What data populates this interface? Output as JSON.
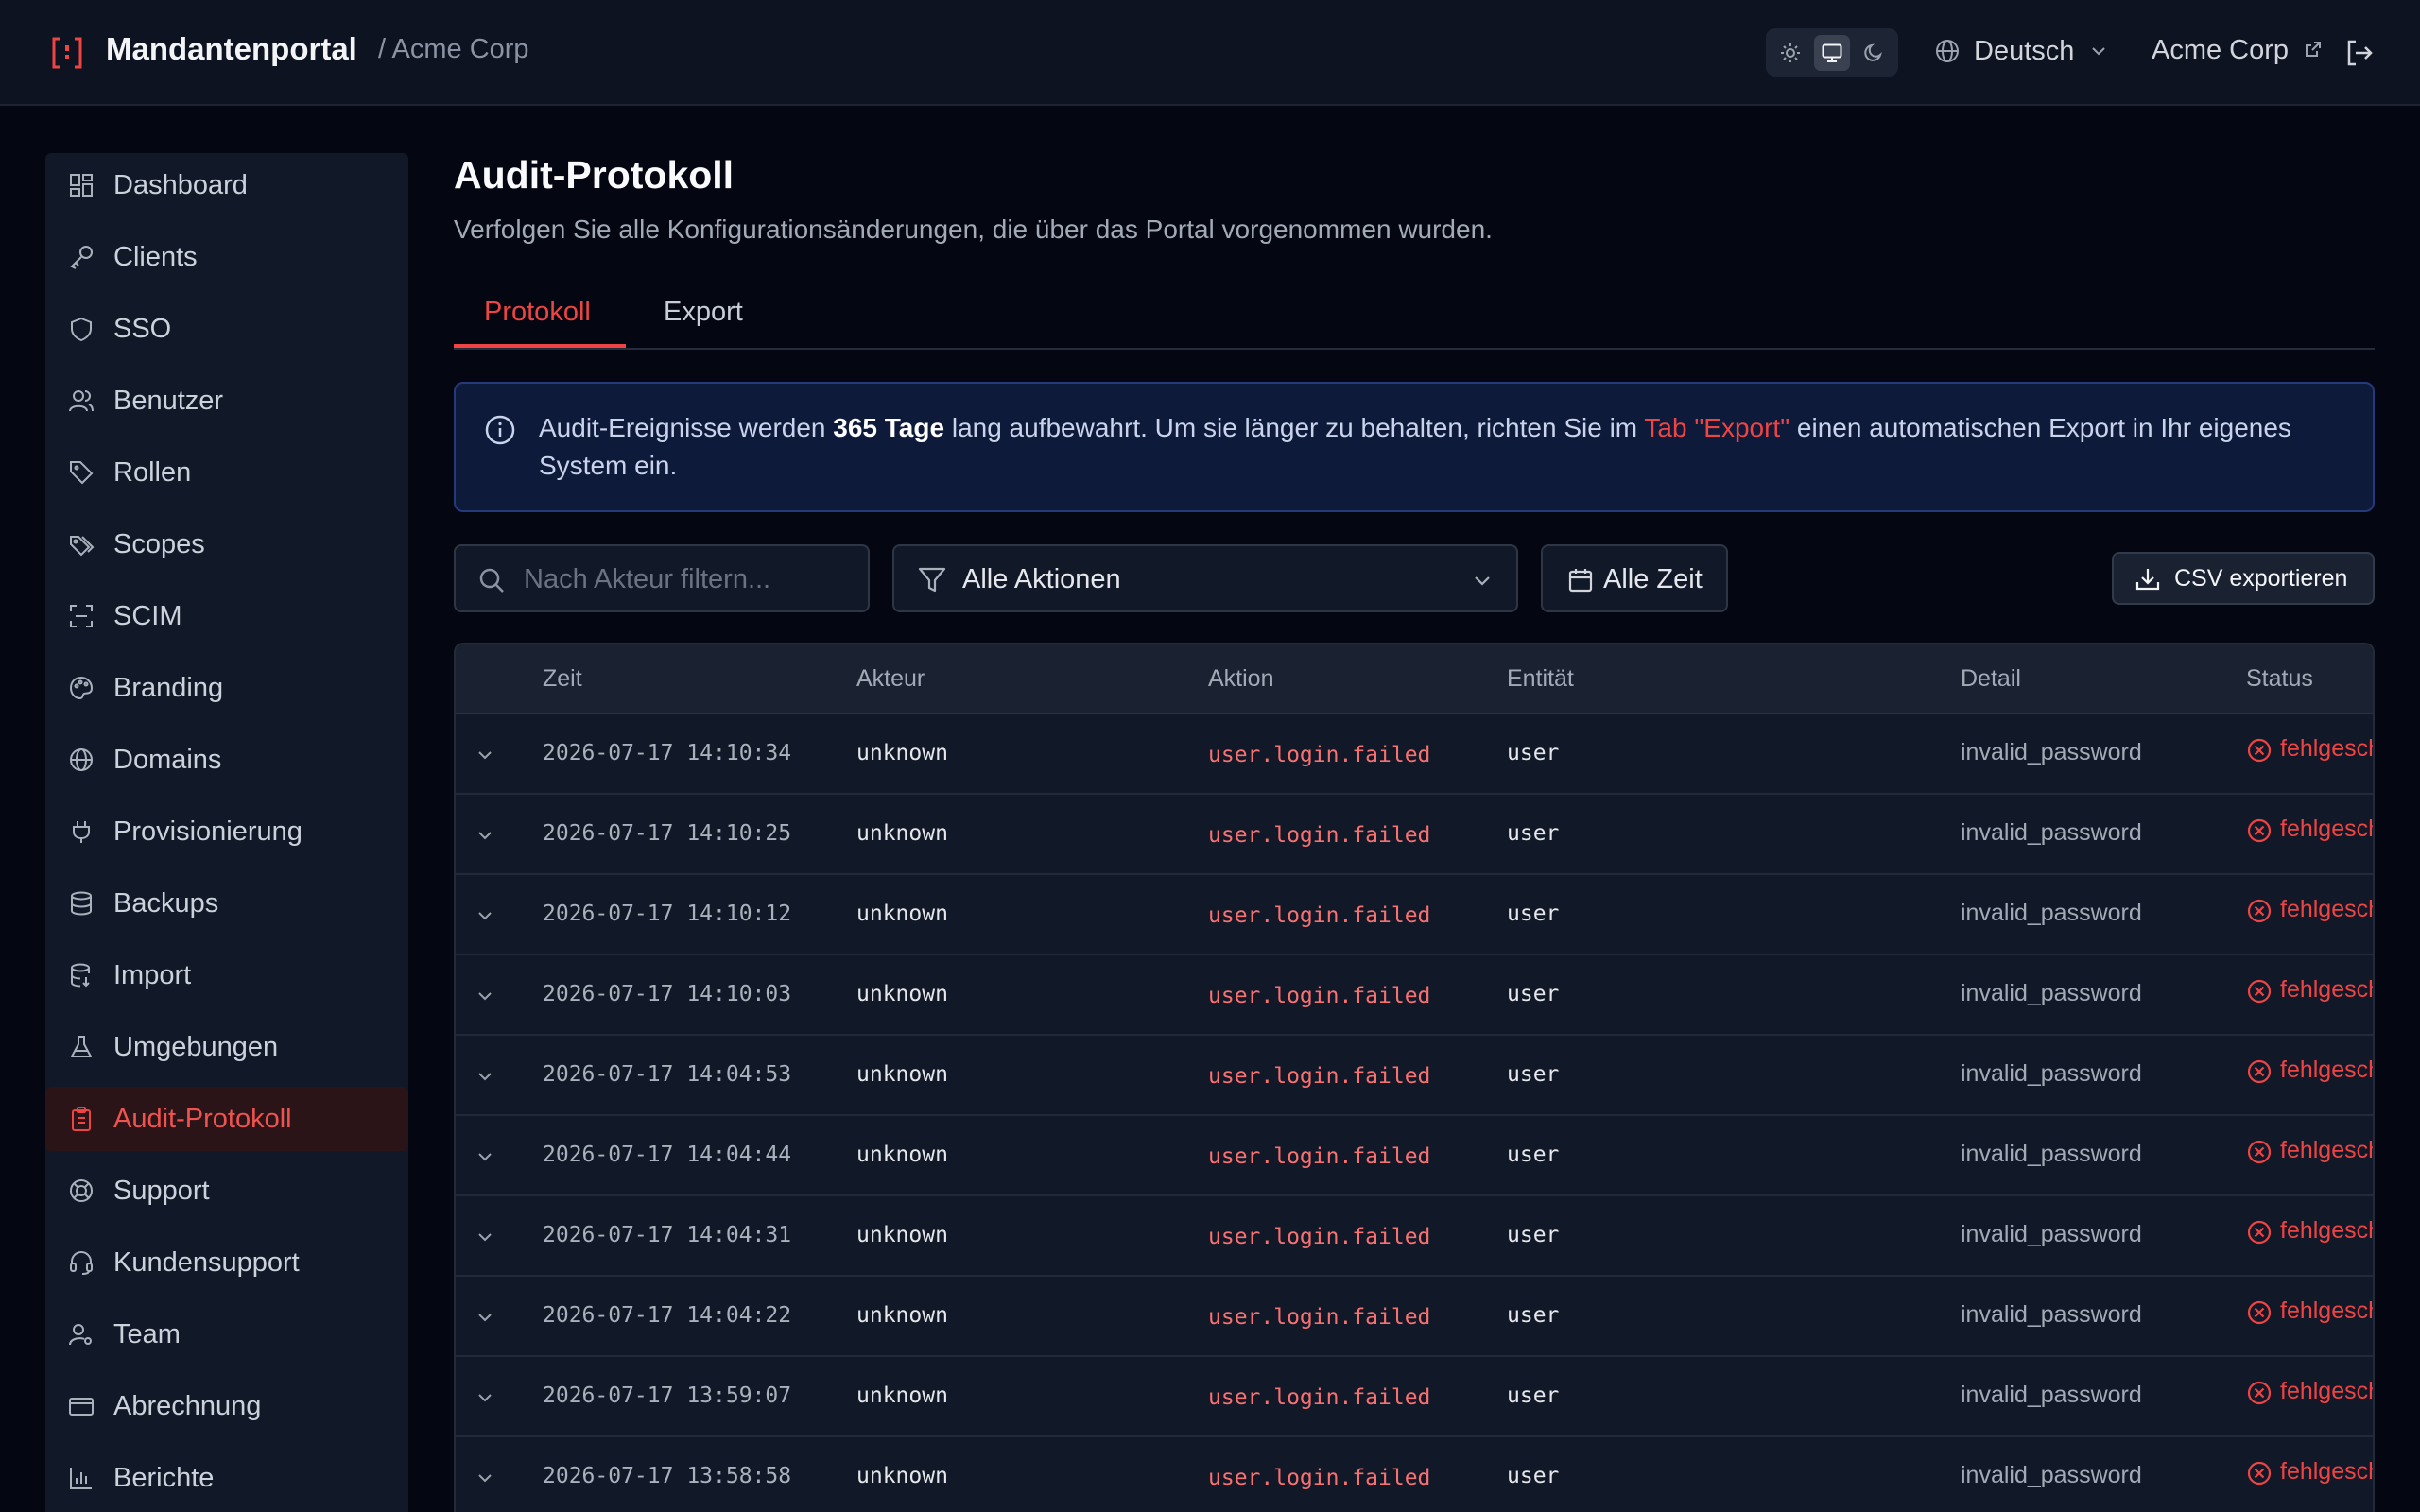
{
  "header": {
    "brand": "Mandantenportal",
    "crumb": "/ Acme Corp",
    "theme_options": [
      "light-icon",
      "monitor-icon",
      "moon-icon"
    ],
    "theme_selected": "monitor-icon",
    "language": "Deutsch",
    "tenant_link": "Acme Corp"
  },
  "sidebar": {
    "items": [
      {
        "label": "Dashboard",
        "icon": "dashboard-icon"
      },
      {
        "label": "Clients",
        "icon": "key-icon"
      },
      {
        "label": "SSO",
        "icon": "shield-icon"
      },
      {
        "label": "Benutzer",
        "icon": "users-icon"
      },
      {
        "label": "Rollen",
        "icon": "tag-icon"
      },
      {
        "label": "Scopes",
        "icon": "tags-icon"
      },
      {
        "label": "SCIM",
        "icon": "scan-icon"
      },
      {
        "label": "Branding",
        "icon": "palette-icon"
      },
      {
        "label": "Domains",
        "icon": "globe-icon"
      },
      {
        "label": "Provisionierung",
        "icon": "plug-icon"
      },
      {
        "label": "Backups",
        "icon": "database-icon"
      },
      {
        "label": "Import",
        "icon": "database-import-icon"
      },
      {
        "label": "Umgebungen",
        "icon": "flask-icon"
      },
      {
        "label": "Audit-Protokoll",
        "icon": "clipboard-icon"
      },
      {
        "label": "Support",
        "icon": "lifebuoy-icon"
      },
      {
        "label": "Kundensupport",
        "icon": "headset-icon"
      },
      {
        "label": "Team",
        "icon": "user-cog-icon"
      },
      {
        "label": "Abrechnung",
        "icon": "credit-card-icon"
      },
      {
        "label": "Berichte",
        "icon": "bar-chart-icon"
      }
    ],
    "active": "Audit-Protokoll"
  },
  "main": {
    "title": "Audit-Protokoll",
    "subtitle": "Verfolgen Sie alle Konfigurationsänderungen, die über das Portal vorgenommen wurden.",
    "tabs": [
      {
        "label": "Protokoll"
      },
      {
        "label": "Export"
      }
    ],
    "active_tab": "Protokoll",
    "info": {
      "part1": "Audit-Ereignisse werden ",
      "bold": "365 Tage",
      "part2": " lang aufbewahrt. Um sie länger zu behalten, richten Sie im ",
      "link": "Tab \"Export\"",
      "part3": " einen automatischen Export in Ihr eigenes System ein."
    },
    "filters": {
      "search_placeholder": "Nach Akteur filtern...",
      "action_select": "Alle Aktionen",
      "date_range": "Alle Zeit",
      "export_button": "CSV exportieren"
    },
    "table": {
      "columns": [
        "Zeit",
        "Akteur",
        "Aktion",
        "Entität",
        "Detail",
        "Status"
      ],
      "rows": [
        {
          "time": "2026-07-17 14:10:34",
          "actor": "unknown",
          "action": "user.login.failed",
          "entity": "user",
          "detail": "invalid_password",
          "status": "fehlgesch"
        },
        {
          "time": "2026-07-17 14:10:25",
          "actor": "unknown",
          "action": "user.login.failed",
          "entity": "user",
          "detail": "invalid_password",
          "status": "fehlgesch"
        },
        {
          "time": "2026-07-17 14:10:12",
          "actor": "unknown",
          "action": "user.login.failed",
          "entity": "user",
          "detail": "invalid_password",
          "status": "fehlgesch"
        },
        {
          "time": "2026-07-17 14:10:03",
          "actor": "unknown",
          "action": "user.login.failed",
          "entity": "user",
          "detail": "invalid_password",
          "status": "fehlgesch"
        },
        {
          "time": "2026-07-17 14:04:53",
          "actor": "unknown",
          "action": "user.login.failed",
          "entity": "user",
          "detail": "invalid_password",
          "status": "fehlgesch"
        },
        {
          "time": "2026-07-17 14:04:44",
          "actor": "unknown",
          "action": "user.login.failed",
          "entity": "user",
          "detail": "invalid_password",
          "status": "fehlgesch"
        },
        {
          "time": "2026-07-17 14:04:31",
          "actor": "unknown",
          "action": "user.login.failed",
          "entity": "user",
          "detail": "invalid_password",
          "status": "fehlgesch"
        },
        {
          "time": "2026-07-17 14:04:22",
          "actor": "unknown",
          "action": "user.login.failed",
          "entity": "user",
          "detail": "invalid_password",
          "status": "fehlgesch"
        },
        {
          "time": "2026-07-17 13:59:07",
          "actor": "unknown",
          "action": "user.login.failed",
          "entity": "user",
          "detail": "invalid_password",
          "status": "fehlgesch"
        },
        {
          "time": "2026-07-17 13:58:58",
          "actor": "unknown",
          "action": "user.login.failed",
          "entity": "user",
          "detail": "invalid_password",
          "status": "fehlgesch"
        }
      ]
    }
  },
  "colors": {
    "accent": "#ef4444",
    "background": "#040711",
    "surface": "#111827",
    "info_bg": "#0e1a3a"
  }
}
